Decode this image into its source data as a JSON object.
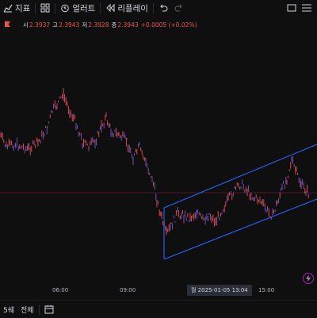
{
  "toolbar": {
    "indicators_label": "지표",
    "alert_label": "얼러트",
    "replay_label": "리플레이"
  },
  "ohlc": {
    "open_label": "시",
    "open_value": "2.3937",
    "high_label": "고",
    "high_value": "2.3943",
    "low_label": "저",
    "low_value": "2.3928",
    "close_label": "종",
    "close_value": "2.3943",
    "change": "+0.0005 (+0.02%)"
  },
  "colors": {
    "price_line": "#e91e63",
    "channel": "#2962ff",
    "bar": "#ef5350",
    "bg": "#0f0f10"
  },
  "xaxis": {
    "ticks": [
      "06:00",
      "09:00",
      "15:00"
    ],
    "crosshair_label": "월 2025-01-05   13:04"
  },
  "bottom": {
    "timeframe": "5쉐",
    "all": "전체"
  }
}
